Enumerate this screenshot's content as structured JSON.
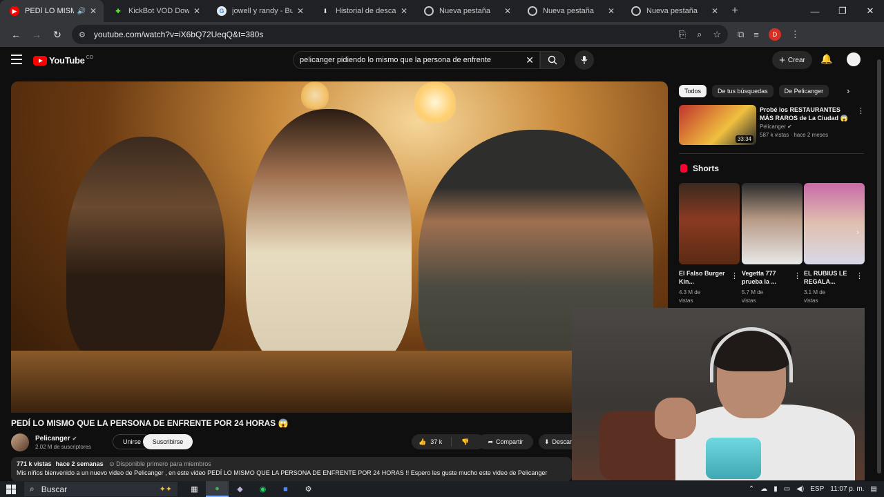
{
  "browser": {
    "tabs": [
      {
        "label": "PEDÍ LO MISMO",
        "active": true,
        "favicon": "youtube-icon",
        "color": "#ff0000"
      },
      {
        "label": "KickBot VOD Dow",
        "active": false,
        "favicon": "kickbot-icon",
        "color": "#53fc18"
      },
      {
        "label": "jowell y randy - Bu",
        "active": false,
        "favicon": "google-icon",
        "color": "#4285f4"
      },
      {
        "label": "Historial de desca",
        "active": false,
        "favicon": "download-icon",
        "color": "#e8eaed"
      },
      {
        "label": "Nueva pestaña",
        "active": false,
        "favicon": "chrome-icon",
        "color": "#e8eaed"
      },
      {
        "label": "Nueva pestaña",
        "active": false,
        "favicon": "chrome-icon",
        "color": "#e8eaed"
      },
      {
        "label": "Nueva pestaña",
        "active": false,
        "favicon": "chrome-icon",
        "color": "#e8eaed"
      }
    ],
    "url": "youtube.com/watch?v=iX6bQ72UeqQ&t=380s",
    "profile_initial": "D"
  },
  "youtube": {
    "logo_text": "YouTube",
    "logo_sup": "CO",
    "search_query": "pelicanger pidiendo lo mismo que la persona de enfrente",
    "create_label": "Crear"
  },
  "video": {
    "title": "PEDÍ LO MISMO QUE LA PERSONA DE ENFRENTE POR 24 HORAS 😱",
    "channel": "Pelicanger",
    "subscribers": "2.02 M de suscriptores",
    "join_label": "Unirse",
    "subscribe_label": "Suscribirse",
    "likes": "37 k",
    "share_label": "Compartir",
    "download_label": "Descargar",
    "views": "771 k vistas",
    "age": "hace 2 semanas",
    "members_note": "Disponible primero para miembros",
    "description": "Mis niños bienvenido a un nuevo video de Pelicanger , en este video PEDÍ LO MISMO QUE LA PERSONA DE ENFRENTE POR 24 HORAS !! Espero les guste mucho este video de Pelicanger"
  },
  "sidebar": {
    "chips": [
      "Todos",
      "De tus búsquedas",
      "De Pelicanger"
    ],
    "recommendation": {
      "title": "Probé los RESTAURANTES MÁS RAROS de La Ciudad 😱",
      "channel": "Pelicanger",
      "stats": "587 k vistas · hace 2 meses",
      "duration": "33:34"
    },
    "shorts_title": "Shorts",
    "shorts": [
      {
        "title": "El Falso Burger Kin...",
        "views": "4.3 M de vistas",
        "thumb_color": "#8a3a22"
      },
      {
        "title": "Vegetta 777 prueba la ...",
        "views": "5.7 M de vistas",
        "thumb_color": "#b89a86"
      },
      {
        "title": "EL RUBIUS LE REGALA...",
        "views": "3.1 M de vistas",
        "thumb_color": "#c86aa8"
      }
    ]
  },
  "taskbar": {
    "search_placeholder": "Buscar",
    "language": "ESP",
    "time": "11:07 p. m."
  }
}
